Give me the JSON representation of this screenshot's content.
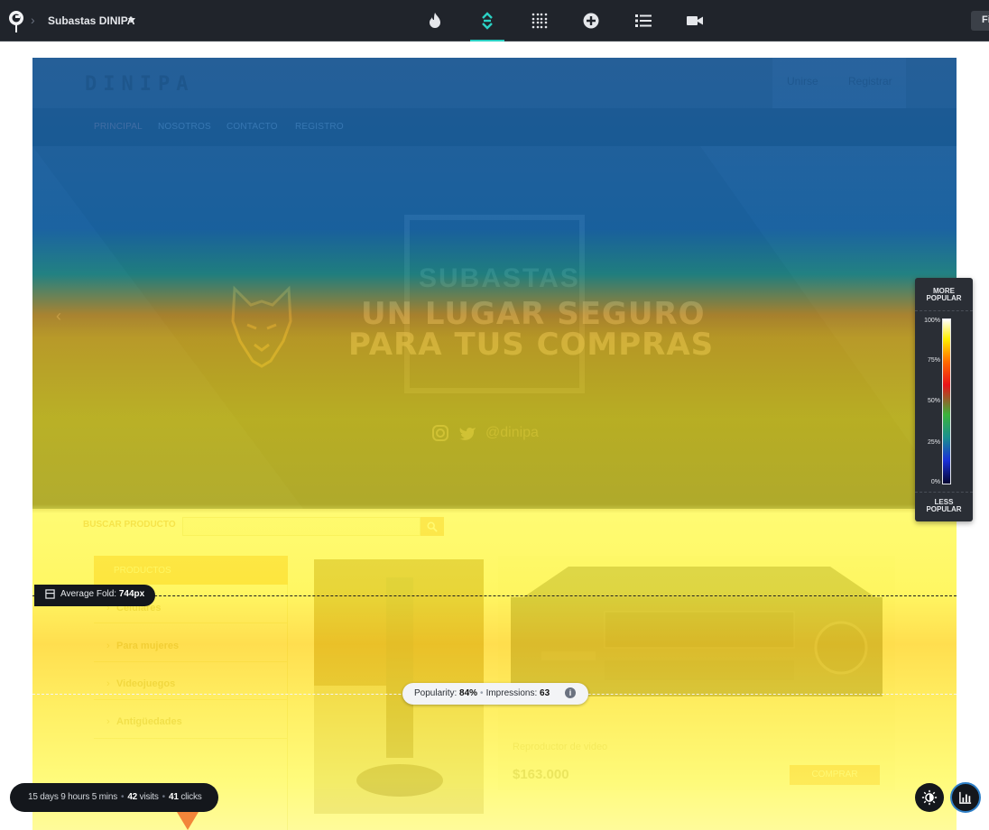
{
  "toolbar": {
    "site_name": "Subastas DINIPA",
    "filter_label": "Fi",
    "tools": [
      "fire-icon",
      "scroll-icon",
      "grid-dots-icon",
      "plus-circle-icon",
      "list-icon",
      "video-camera-icon"
    ],
    "active_tool": "scroll-icon",
    "accent": "#2bd1c4"
  },
  "site": {
    "brand": "DINIPA",
    "header_links": {
      "join": "Unirse",
      "register": "Registrar"
    },
    "nav": [
      "PRINCIPAL",
      "NOSOTROS",
      "CONTACTO",
      "REGISTRO"
    ],
    "hero": {
      "box_text": "SUBASTAS",
      "line1": "UN LUGAR SEGURO",
      "line2": "PARA TUS COMPRAS",
      "handle": "@dinipa"
    },
    "search_label": "BUSCAR PRODUCTO",
    "categories_title": "PRODUCTOS",
    "categories": [
      "Celulares",
      "Para mujeres",
      "Videojuegos",
      "Antigüedades"
    ],
    "product": {
      "name": "Reproductor de video",
      "price": "$163.000",
      "buy_label": "COMPRAR"
    }
  },
  "fold": {
    "label": "Average Fold:",
    "value": "744px"
  },
  "popularity": {
    "popularity_label": "Popularity:",
    "popularity_value": "84%",
    "impressions_label": "Impressions:",
    "impressions_value": "63"
  },
  "legend": {
    "top_line1": "MORE",
    "top_line2": "POPULAR",
    "bottom_line1": "LESS",
    "bottom_line2": "POPULAR",
    "ticks": [
      "100%",
      "75%",
      "50%",
      "25%",
      "0%"
    ]
  },
  "stats": {
    "duration": "15 days 9 hours 5 mins",
    "visits_value": "42",
    "visits_label": "visits",
    "clicks_value": "41",
    "clicks_label": "clicks"
  }
}
